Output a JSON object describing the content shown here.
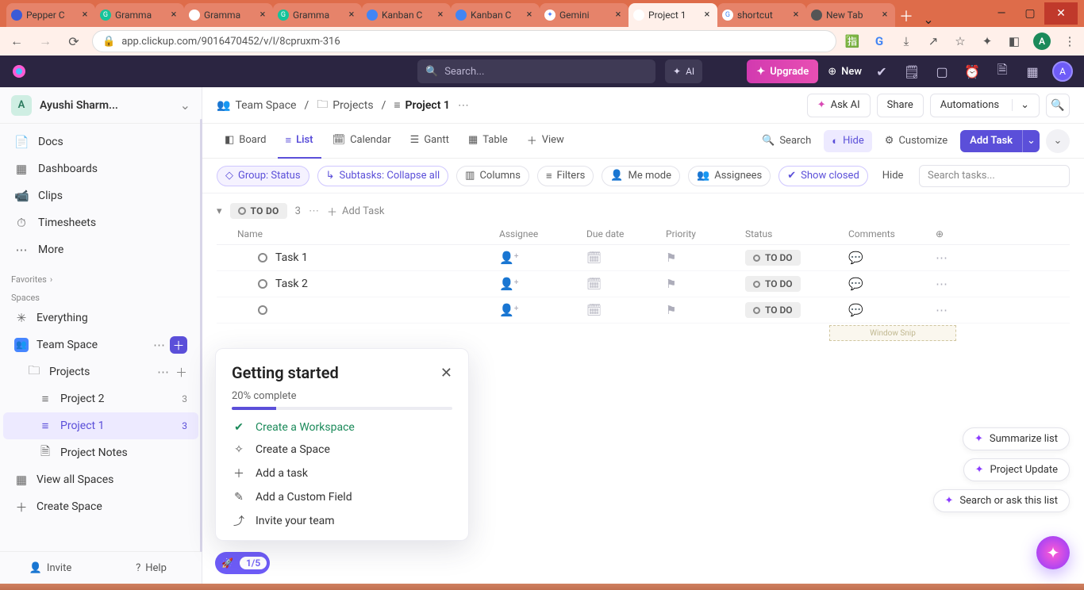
{
  "browser": {
    "tabs": [
      {
        "label": "Pepper C",
        "favicon_bg": "#3b5bd6",
        "favicon_txt": "",
        "favicon_color": "#fff"
      },
      {
        "label": "Gramma",
        "favicon_bg": "#15c39a",
        "favicon_txt": "G",
        "favicon_color": "#fff"
      },
      {
        "label": "Gramma",
        "favicon_bg": "#ffffff",
        "favicon_txt": "",
        "favicon_color": "#15c39a"
      },
      {
        "label": "Gramma",
        "favicon_bg": "#15c39a",
        "favicon_txt": "G",
        "favicon_color": "#fff"
      },
      {
        "label": "Kanban C",
        "favicon_bg": "#4285f4",
        "favicon_txt": "",
        "favicon_color": "#fff"
      },
      {
        "label": "Kanban C",
        "favicon_bg": "#4285f4",
        "favicon_txt": "",
        "favicon_color": "#fff"
      },
      {
        "label": "Gemini",
        "favicon_bg": "#ffffff",
        "favicon_txt": "✦",
        "favicon_color": "#4b7bff"
      },
      {
        "label": "Project 1",
        "favicon_bg": "#ffffff",
        "favicon_txt": "",
        "favicon_color": "#ff4fa3",
        "active": true
      },
      {
        "label": "shortcut",
        "favicon_bg": "#ffffff",
        "favicon_txt": "G",
        "favicon_color": "#4285f4"
      },
      {
        "label": "New Tab",
        "favicon_bg": "#555555",
        "favicon_txt": "",
        "favicon_color": "#fff"
      }
    ],
    "url": "app.clickup.com/9016470452/v/l/8cpruxm-316",
    "profile_initial": "A"
  },
  "app_top": {
    "search_placeholder": "Search...",
    "ai": "AI",
    "upgrade": "Upgrade",
    "new": "New",
    "profile_initial": "A"
  },
  "sidebar": {
    "workspace_initial": "A",
    "workspace_name": "Ayushi Sharm...",
    "nav": [
      {
        "icon": "📄",
        "label": "Docs"
      },
      {
        "icon": "▦",
        "label": "Dashboards"
      },
      {
        "icon": "📹",
        "label": "Clips"
      },
      {
        "icon": "⏱",
        "label": "Timesheets"
      },
      {
        "icon": "⋯",
        "label": "More"
      }
    ],
    "favorites_label": "Favorites",
    "spaces_label": "Spaces",
    "everything": "Everything",
    "team_space": "Team Space",
    "projects": "Projects",
    "project2": {
      "label": "Project 2",
      "count": "3"
    },
    "project1": {
      "label": "Project 1",
      "count": "3"
    },
    "project_notes": "Project Notes",
    "view_all": "View all Spaces",
    "create_space": "Create Space",
    "invite": "Invite",
    "help": "Help"
  },
  "crumbs": {
    "team_space": "Team Space",
    "projects": "Projects",
    "project": "Project 1",
    "ask_ai": "Ask AI",
    "share": "Share",
    "automations": "Automations"
  },
  "views": {
    "board": "Board",
    "list": "List",
    "calendar": "Calendar",
    "gantt": "Gantt",
    "table": "Table",
    "view": "View",
    "search": "Search",
    "hide": "Hide",
    "customize": "Customize",
    "add_task": "Add Task"
  },
  "filters": {
    "group": "Group: Status",
    "subtasks": "Subtasks: Collapse all",
    "columns": "Columns",
    "filters": "Filters",
    "me": "Me mode",
    "assignees": "Assignees",
    "closed": "Show closed",
    "hide": "Hide",
    "search_placeholder": "Search tasks..."
  },
  "group": {
    "status": "TO DO",
    "count": "3",
    "add_task": "Add Task"
  },
  "columns": {
    "name": "Name",
    "assignee": "Assignee",
    "due": "Due date",
    "priority": "Priority",
    "status": "Status",
    "comments": "Comments"
  },
  "tasks": [
    {
      "name": "Task 1",
      "status": "TO DO"
    },
    {
      "name": "Task 2",
      "status": "TO DO"
    },
    {
      "name": "",
      "status": "TO DO"
    }
  ],
  "getting_started": {
    "title": "Getting started",
    "progress_text": "20% complete",
    "progress_pct": 20,
    "items": [
      {
        "label": "Create a Workspace",
        "done": true,
        "icon": "✔"
      },
      {
        "label": "Create a Space",
        "done": false,
        "icon": "✧"
      },
      {
        "label": "Add a task",
        "done": false,
        "icon": "＋"
      },
      {
        "label": "Add a Custom Field",
        "done": false,
        "icon": "✎"
      },
      {
        "label": "Invite your team",
        "done": false,
        "icon": "⤴"
      }
    ],
    "badge": "1/5"
  },
  "float": {
    "summarize": "Summarize list",
    "update": "Project Update",
    "search": "Search or ask this list"
  },
  "snip": "Window Snip"
}
